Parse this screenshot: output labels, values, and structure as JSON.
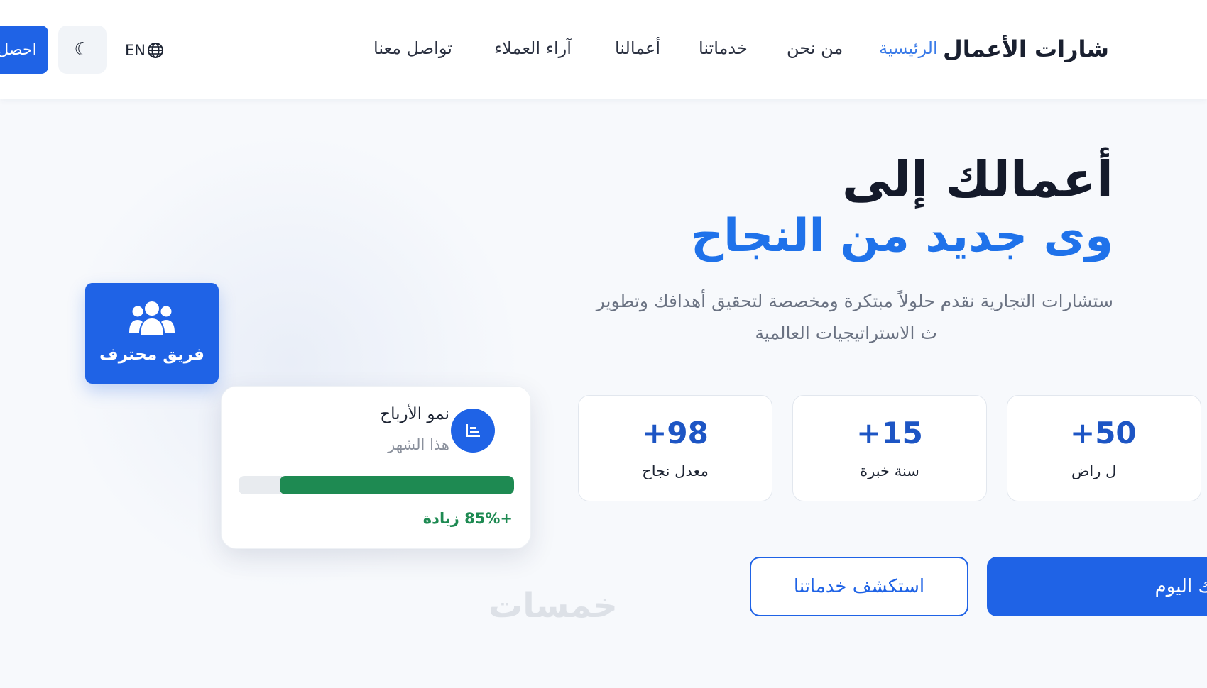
{
  "header": {
    "brand": "شارات الأعمال",
    "nav": [
      {
        "label": "الرئيسية",
        "active": true
      },
      {
        "label": "من نحن"
      },
      {
        "label": "خدماتنا"
      },
      {
        "label": "أعمالنا"
      },
      {
        "label": "آراء العملاء"
      },
      {
        "label": "تواصل معنا"
      }
    ],
    "lang_label": "EN",
    "cta_label": "احصل"
  },
  "hero": {
    "title_line1": "أعمالك إلى",
    "title_line2": "وى جديد من النجاح",
    "desc_line1": "ستشارات التجارية نقدم حلولاً مبتكرة ومخصصة لتحقيق أهدافك وتطوير",
    "desc_line2": "ث الاستراتيجيات العالمية",
    "stats": [
      {
        "value": "+98",
        "label": "معدل نجاح"
      },
      {
        "value": "+15",
        "label": "سنة خبرة"
      },
      {
        "value": "+50",
        "label": "ل راض"
      }
    ],
    "buttons": {
      "explore": "استكشف خدماتنا",
      "start": "روعك اليوم"
    }
  },
  "team_card": {
    "label": "فريق محترف"
  },
  "profit_card": {
    "title": "نمو الأرباح",
    "subtitle": "هذا الشهر",
    "progress": 0.85,
    "increase": "+85% زيادة"
  },
  "watermark": "خمسات",
  "colors": {
    "primary": "#1f63e6",
    "accent": "#1f72ea",
    "success": "#1e8a52"
  }
}
